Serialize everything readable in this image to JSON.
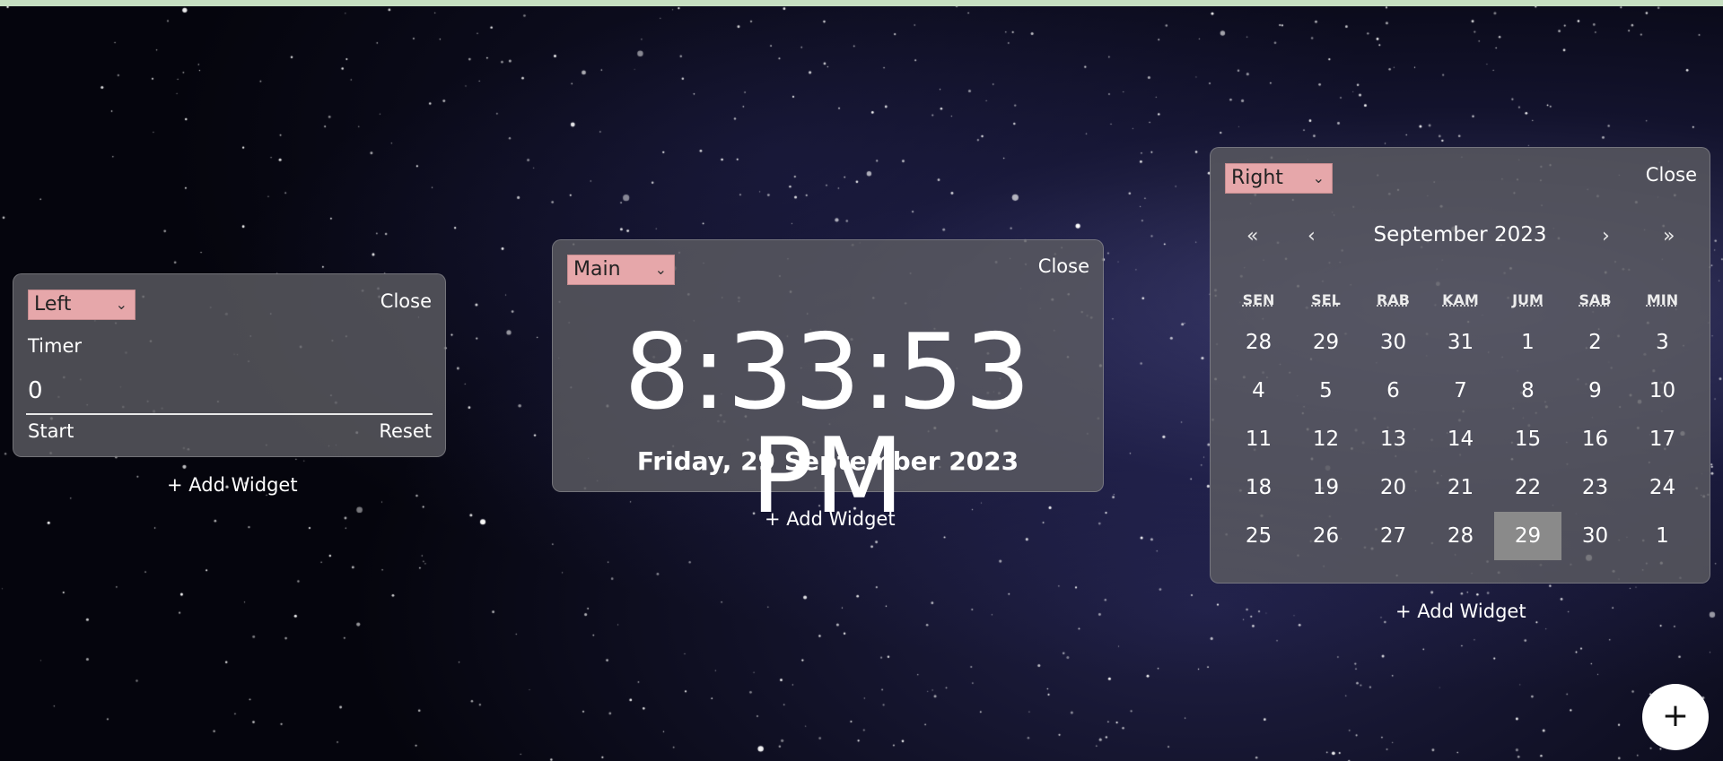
{
  "left_panel": {
    "position_select": "Left",
    "close_label": "Close",
    "timer": {
      "title": "Timer",
      "value": "0",
      "start_label": "Start",
      "reset_label": "Reset"
    },
    "add_widget_label": "+ Add Widget"
  },
  "main_panel": {
    "position_select": "Main",
    "close_label": "Close",
    "clock": {
      "time": "8:33:53 PM",
      "date": "Friday, 29 September 2023"
    },
    "add_widget_label": "+ Add Widget"
  },
  "right_panel": {
    "position_select": "Right",
    "close_label": "Close",
    "calendar": {
      "nav": {
        "prev_year": "«",
        "prev_month": "‹",
        "next_month": "›",
        "next_year": "»"
      },
      "month_label": "September 2023",
      "weekdays": [
        "SEN",
        "SEL",
        "RAB",
        "KAM",
        "JUM",
        "SAB",
        "MIN"
      ],
      "weeks": [
        [
          "28",
          "29",
          "30",
          "31",
          "1",
          "2",
          "3"
        ],
        [
          "4",
          "5",
          "6",
          "7",
          "8",
          "9",
          "10"
        ],
        [
          "11",
          "12",
          "13",
          "14",
          "15",
          "16",
          "17"
        ],
        [
          "18",
          "19",
          "20",
          "21",
          "22",
          "23",
          "24"
        ],
        [
          "25",
          "26",
          "27",
          "28",
          "29",
          "30",
          "1"
        ]
      ],
      "selected_day": "29"
    },
    "add_widget_label": "+ Add Widget"
  },
  "fab_label": "+",
  "colors": {
    "select_bg": "#e6a7aa",
    "top_bar": "#c6dfc1",
    "today_highlight": "#8a8a8a"
  }
}
